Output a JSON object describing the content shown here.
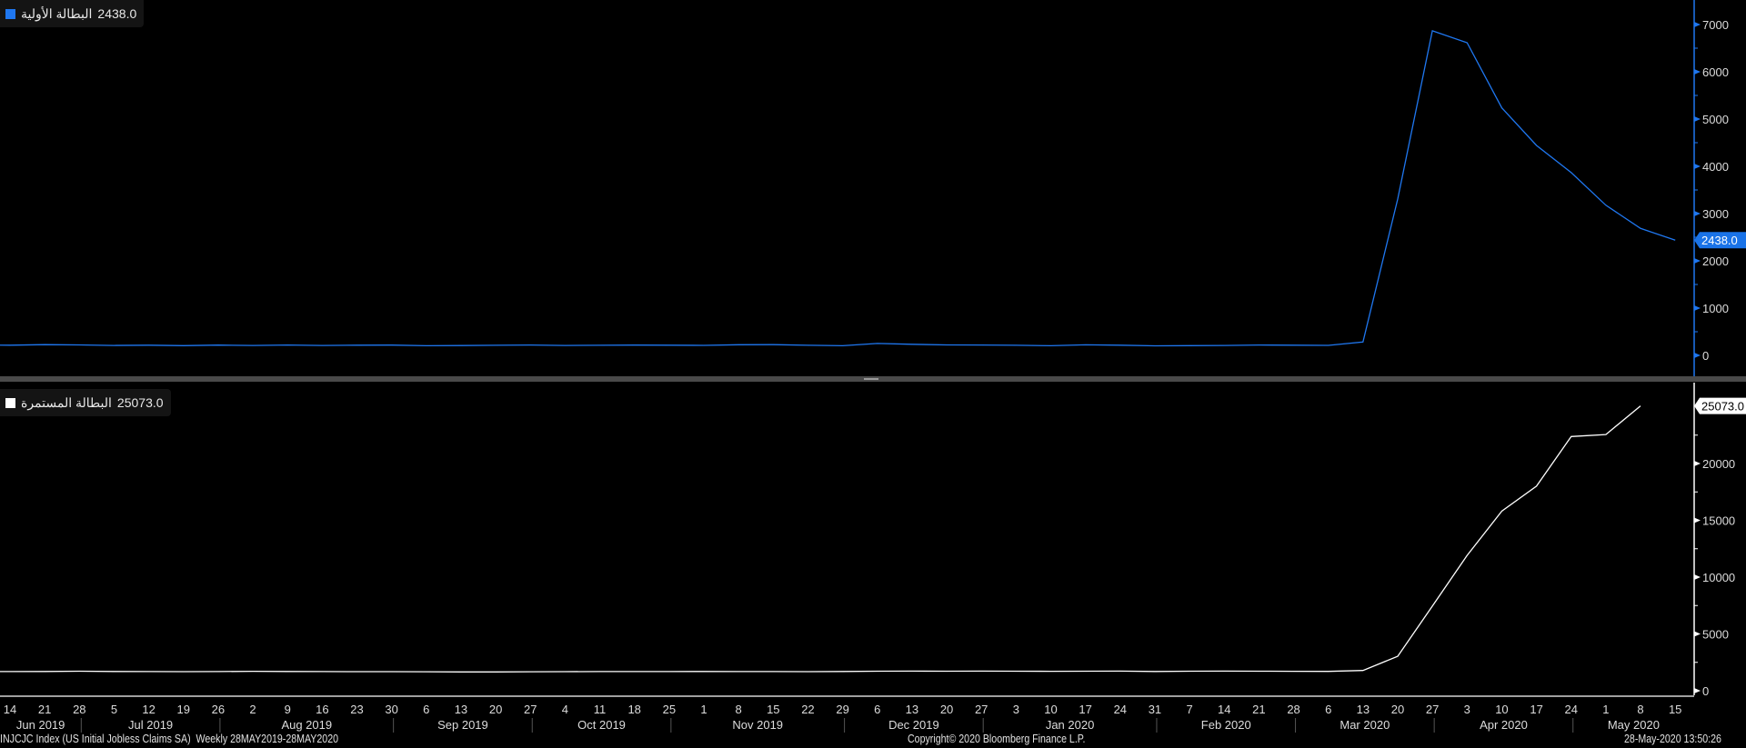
{
  "colors": {
    "initial": "#1f77f0",
    "continuing": "#ffffff",
    "axis_text": "#dcdcdc",
    "background": "#000000"
  },
  "legend_top": {
    "name": "البطالة الأولية",
    "value": "2438.0"
  },
  "legend_bottom": {
    "name": "البطالة المستمرة",
    "value": "25073.0"
  },
  "footer": {
    "left": "INJCJC Index (US Initial Jobless Claims SA)  Weekly 28MAY2019-28MAY2020",
    "center": "Copyright© 2020 Bloomberg Finance L.P.",
    "right": "28-May-2020 13:50:26"
  },
  "chart_data": [
    {
      "type": "line",
      "title": "البطالة الأولية",
      "series": [
        {
          "name": "البطالة الأولية",
          "last_value": "2438.0",
          "start": "2019-06-07",
          "values": [
            222,
            216,
            227,
            221,
            209,
            216,
            206,
            217,
            209,
            220,
            209,
            215,
            217,
            204,
            208,
            213,
            219,
            210,
            214,
            218,
            215,
            211,
            225,
            227,
            213,
            203,
            252,
            234,
            222,
            220,
            214,
            204,
            223,
            216,
            202,
            205,
            210,
            219,
            216,
            211,
            282,
            3307,
            6867,
            6615,
            5237,
            4442,
            3867,
            3176,
            2687,
            2438
          ]
        }
      ],
      "ylim": [
        -300,
        7500
      ],
      "yticks": [
        "0",
        "1000",
        "2000",
        "3000",
        "4000",
        "5000",
        "6000",
        "7000"
      ],
      "ytick_values": [
        0,
        1000,
        2000,
        3000,
        4000,
        5000,
        6000,
        7000
      ],
      "axis": "right"
    },
    {
      "type": "line",
      "title": "البطالة المستمرة",
      "series": [
        {
          "name": "البطالة المستمرة",
          "last_value": "25073.0",
          "start": "2019-06-07",
          "values": [
            1690,
            1690,
            1700,
            1720,
            1700,
            1690,
            1680,
            1690,
            1710,
            1700,
            1690,
            1680,
            1680,
            1670,
            1660,
            1660,
            1670,
            1680,
            1690,
            1690,
            1690,
            1700,
            1690,
            1690,
            1680,
            1700,
            1720,
            1730,
            1720,
            1730,
            1720,
            1710,
            1720,
            1730,
            1700,
            1720,
            1730,
            1720,
            1710,
            1702,
            1784,
            3029,
            7446,
            11914,
            15819,
            18011,
            22377,
            22548,
            25073
          ]
        }
      ],
      "ylim": [
        -500,
        26000
      ],
      "yticks": [
        "0",
        "5000",
        "10000",
        "15000",
        "20000"
      ],
      "ytick_values": [
        0,
        5000,
        10000,
        15000,
        20000
      ],
      "axis": "right"
    }
  ],
  "x_axis": {
    "tick_start": "2019-06-14",
    "ticks": [
      "14",
      "21",
      "28",
      "5",
      "12",
      "19",
      "26",
      "2",
      "9",
      "16",
      "23",
      "30",
      "6",
      "13",
      "20",
      "27",
      "4",
      "11",
      "18",
      "25",
      "1",
      "8",
      "15",
      "22",
      "29",
      "6",
      "13",
      "20",
      "27",
      "3",
      "10",
      "17",
      "24",
      "31",
      "7",
      "14",
      "21",
      "28",
      "6",
      "13",
      "20",
      "27",
      "3",
      "10",
      "17",
      "24",
      "1",
      "8",
      "15"
    ],
    "months": [
      {
        "label": "Jun 2019",
        "ticks": 3
      },
      {
        "label": "Jul 2019",
        "ticks": 4
      },
      {
        "label": "Aug 2019",
        "ticks": 5
      },
      {
        "label": "Sep 2019",
        "ticks": 4
      },
      {
        "label": "Oct 2019",
        "ticks": 4
      },
      {
        "label": "Nov 2019",
        "ticks": 5
      },
      {
        "label": "Dec 2019",
        "ticks": 4
      },
      {
        "label": "Jan 2020",
        "ticks": 5
      },
      {
        "label": "Feb 2020",
        "ticks": 4
      },
      {
        "label": "Mar 2020",
        "ticks": 4
      },
      {
        "label": "Apr 2020",
        "ticks": 4
      },
      {
        "label": "May 2020",
        "ticks": 3
      }
    ]
  }
}
